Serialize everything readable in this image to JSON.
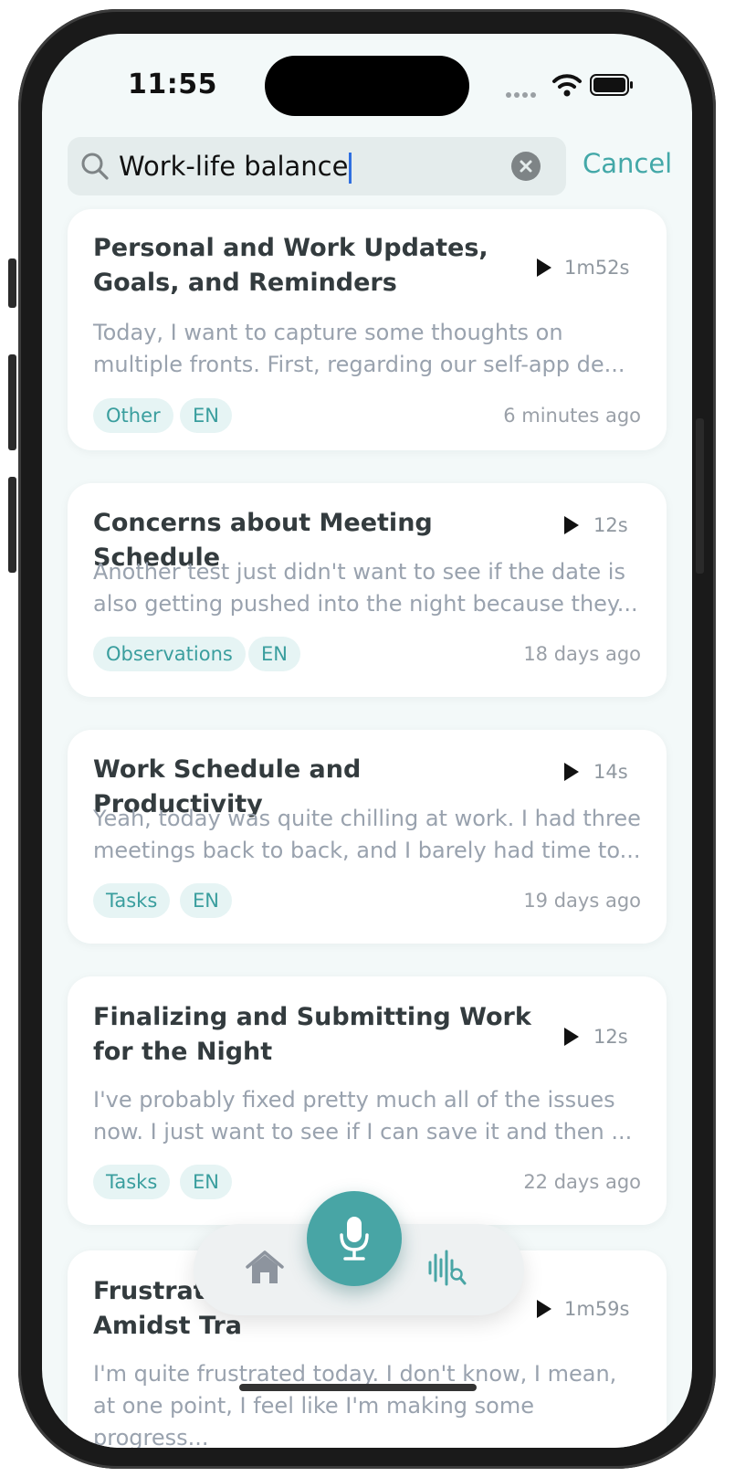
{
  "status_bar": {
    "time": "11:55"
  },
  "search": {
    "query": "Work-life balance",
    "cancel_label": "Cancel"
  },
  "recordings": [
    {
      "title": "Personal and Work Updates, Goals, and Reminders",
      "duration": "1m52s",
      "excerpt": "Today, I want to capture some thoughts on multiple fronts. First, regarding our self-app de...",
      "category": "Other",
      "language": "EN",
      "ago": "6 minutes ago"
    },
    {
      "title": "Concerns about Meeting Schedule",
      "duration": "12s",
      "excerpt": "Another test just didn't want to see if the date is also getting pushed into the night because they...",
      "category": "Observations",
      "language": "EN",
      "ago": "18 days ago"
    },
    {
      "title": "Work Schedule and Productivity",
      "duration": "14s",
      "excerpt": "Yeah, today was quite chilling at work. I had three meetings back to back, and I barely had time to...",
      "category": "Tasks",
      "language": "EN",
      "ago": "19 days ago"
    },
    {
      "title": "Finalizing and Submitting Work for the Night",
      "duration": "12s",
      "excerpt": "I've probably fixed pretty much all of the issues now. I just want to see if I can save it and then ...",
      "category": "Tasks",
      "language": "EN",
      "ago": "22 days ago"
    },
    {
      "title": "Frustration Amidst Tra",
      "duration": "1m59s",
      "excerpt": "I'm quite frustrated today. I don't know, I mean, at one point, I feel like I'm making some progress..."
    }
  ],
  "tabbar": {
    "items": [
      "home-icon",
      "microphone-icon",
      "voice-search-icon"
    ]
  },
  "colors": {
    "accent": "#48a5a5",
    "background": "#f3f9f9",
    "tag_bg": "#e6f4f4"
  }
}
